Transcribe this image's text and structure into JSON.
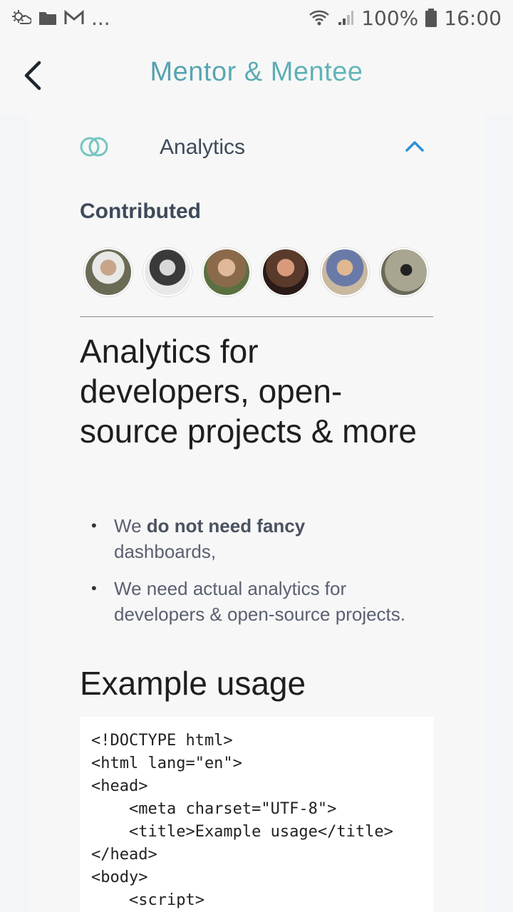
{
  "status_bar": {
    "battery": "100%",
    "time": "16:00",
    "more": "..."
  },
  "app_bar": {
    "title": "Mentor & Mentee"
  },
  "accordion": {
    "title": "Analytics",
    "expanded": true
  },
  "contributed": {
    "label": "Contributed",
    "avatars": [
      {
        "name": "avatar-1",
        "color": "#6b6a55"
      },
      {
        "name": "avatar-2",
        "color": "#3a3a3a"
      },
      {
        "name": "avatar-3",
        "color": "#8a6a4a"
      },
      {
        "name": "avatar-4",
        "color": "#5a3a2a"
      },
      {
        "name": "avatar-5",
        "color": "#9a8070"
      },
      {
        "name": "avatar-6",
        "color": "#8a8878"
      }
    ]
  },
  "content": {
    "heading": "Analytics for developers, open-source projects & more",
    "bullet_1_prefix": "We ",
    "bullet_1_bold": "do not need fancy",
    "bullet_1_suffix": " dashboards,",
    "bullet_2": "We need actual analytics for developers & open-source projects.",
    "example_heading": "Example usage",
    "code": "<!DOCTYPE html>\n<html lang=\"en\">\n<head>\n    <meta charset=\"UTF-8\">\n    <title>Example usage</title>\n</head>\n<body>\n    <script>"
  },
  "colors": {
    "accent": "#2d8fd6",
    "title_gradient_start": "#4a8ea8",
    "title_gradient_end": "#6cc8c0"
  }
}
